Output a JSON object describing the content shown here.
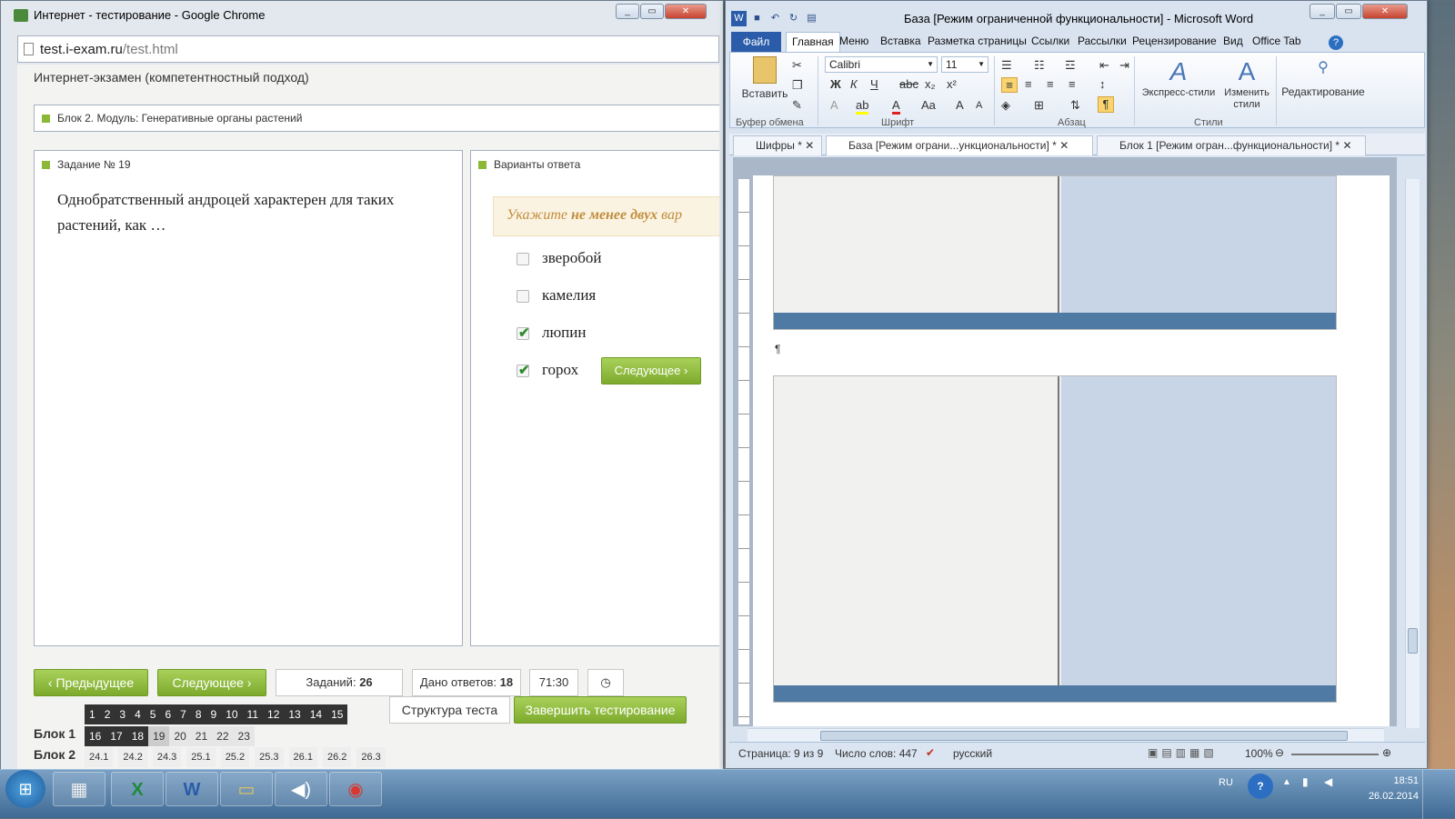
{
  "chrome": {
    "title": "Интернет - тестирование - Google Chrome",
    "url_host": "test.i-exam.ru",
    "url_path": "/test.html",
    "page_title": "Интернет-экзамен (компетентностный подход)",
    "block_label": "Блок 2. Модуль: Генеративные органы растений",
    "task_label": "Задание № 19",
    "question": "Однобратственный андроцей характерен для таких растений, как …",
    "answers_label": "Варианты ответа",
    "hint": "Укажите не менее двух вар",
    "hint_emph": "не менее двух",
    "options": [
      {
        "label": "зверобой",
        "checked": false
      },
      {
        "label": "камелия",
        "checked": false
      },
      {
        "label": "люпин",
        "checked": true
      },
      {
        "label": "горох",
        "checked": true
      }
    ],
    "next_inline": "Следующее",
    "prev_btn": "Предыдущее",
    "next_btn": "Следующее",
    "tasks_label": "Заданий:",
    "tasks_count": "26",
    "answered_label": "Дано ответов:",
    "answered_count": "18",
    "timer": "71:30",
    "structure_btn": "Структура теста",
    "finish_btn": "Завершить тестирование",
    "block1_label": "Блок 1",
    "block2_label": "Блок 2",
    "top_numbers": [
      "1",
      "2",
      "3",
      "4",
      "5",
      "6",
      "7",
      "8",
      "9",
      "10",
      "11",
      "12",
      "13",
      "14",
      "15"
    ],
    "block1_numbers": [
      "16",
      "17",
      "18",
      "19",
      "20",
      "21",
      "22",
      "23"
    ],
    "block1_current": "19",
    "block2_numbers": [
      "24.1",
      "24.2",
      "24.3",
      "25.1",
      "25.2",
      "25.3",
      "26.1",
      "26.2",
      "26.3"
    ]
  },
  "word": {
    "title": "База [Режим ограниченной функциональности] - Microsoft Word",
    "file_tab": "Файл",
    "tabs": [
      "Главная",
      "Меню",
      "Вставка",
      "Разметка страницы",
      "Ссылки",
      "Рассылки",
      "Рецензирование",
      "Вид",
      "Office Tab"
    ],
    "paste_label": "Вставить",
    "font_name": "Calibri",
    "font_size": "11",
    "express_styles": "Экспресс-стили",
    "change_styles": "Изменить стили",
    "editing": "Редактирование",
    "groups": [
      "Буфер обмена",
      "Шрифт",
      "Абзац",
      "Стили"
    ],
    "doc_tabs": [
      "Шифры *",
      "База [Режим ограни...ункциональности] *",
      "Блок 1 [Режим огран...функциональности] *"
    ],
    "status_page": "Страница: 9 из 9",
    "status_words": "Число слов: 447",
    "status_lang": "русский",
    "zoom": "100%",
    "pilcrow": "¶"
  },
  "taskbar": {
    "lang": "RU",
    "time": "18:51",
    "date": "26.02.2014"
  }
}
